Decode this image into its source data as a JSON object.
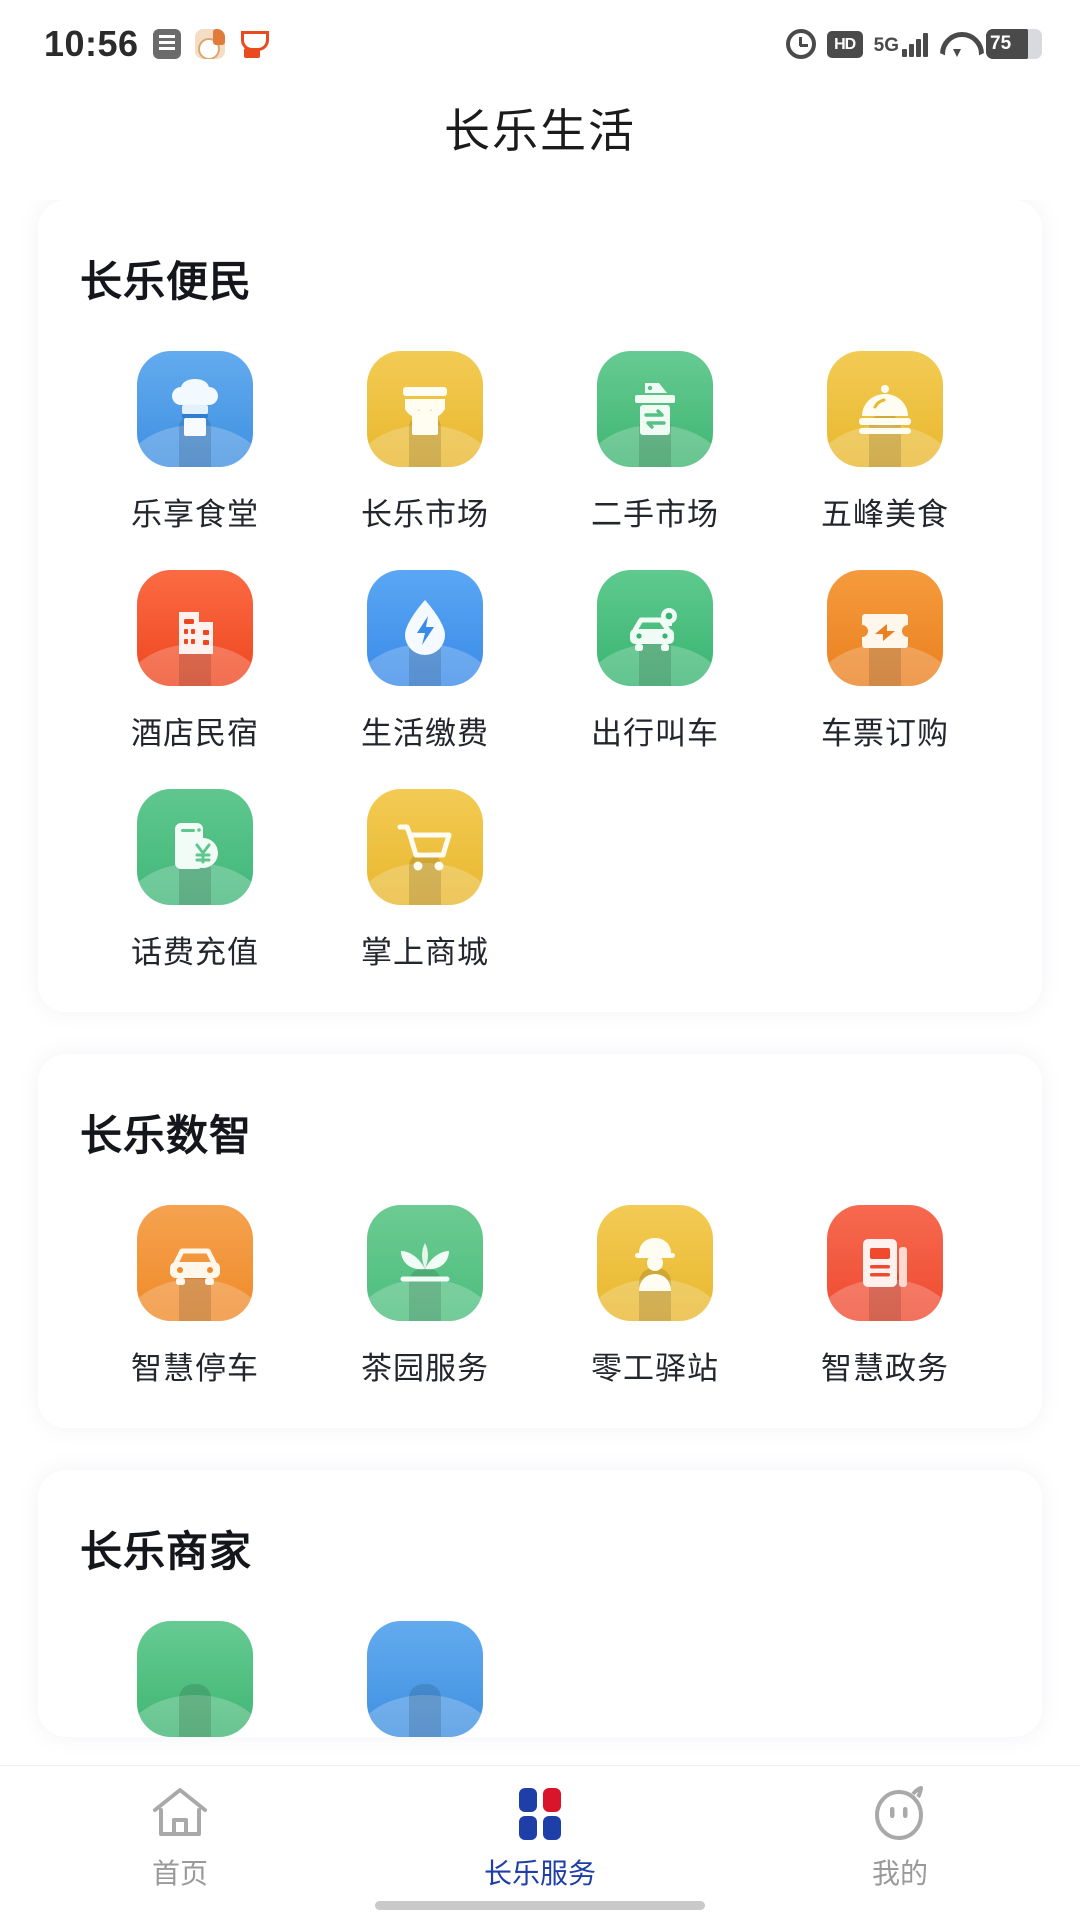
{
  "status_bar": {
    "time": "10:56",
    "left_icons": [
      "document-icon",
      "bear-app-icon",
      "cup-app-icon"
    ],
    "right_icons": [
      "alarm-icon",
      "hd-icon",
      "signal-5g-icon",
      "wifi-icon",
      "battery-icon"
    ],
    "hd_label": "HD",
    "network_label": "5G",
    "battery_level": "75"
  },
  "header": {
    "title": "长乐生活"
  },
  "sections": [
    {
      "title": "长乐便民",
      "items": [
        {
          "label": "乐享食堂",
          "icon": "chef-hat-icon",
          "color": "#4a9ce8",
          "color2": "#6fb6f2"
        },
        {
          "label": "长乐市场",
          "icon": "storefront-icon",
          "color": "#eec03c",
          "color2": "#f5d469"
        },
        {
          "label": "二手市场",
          "icon": "recycle-box-icon",
          "color": "#4fbf7e",
          "color2": "#74d49a"
        },
        {
          "label": "五峰美食",
          "icon": "food-cloche-icon",
          "color": "#eec03c",
          "color2": "#f5d469"
        },
        {
          "label": "酒店民宿",
          "icon": "hotel-building-icon",
          "color": "#f4502a",
          "color2": "#fa7350"
        },
        {
          "label": "生活缴费",
          "icon": "water-drop-bolt-icon",
          "color": "#3e92ef",
          "color2": "#68aef7"
        },
        {
          "label": "出行叫车",
          "icon": "taxi-car-icon",
          "color": "#46bd7b",
          "color2": "#6ed29b"
        },
        {
          "label": "车票订购",
          "icon": "ticket-icon",
          "color": "#ef8b2a",
          "color2": "#f7a busy"
        },
        {
          "label": "话费充值",
          "icon": "phone-recharge-icon",
          "color": "#54bd85",
          "color2": "#7ad2a3"
        },
        {
          "label": "掌上商城",
          "icon": "shopping-cart-icon",
          "color": "#eec03c",
          "color2": "#f5d469"
        }
      ]
    },
    {
      "title": "长乐数智",
      "items": [
        {
          "label": "智慧停车",
          "icon": "parking-car-icon",
          "color": "#f0902f",
          "color2": "#f7af5f"
        },
        {
          "label": "茶园服务",
          "icon": "tea-leaf-icon",
          "color": "#5cc080",
          "color2": "#80d4a0"
        },
        {
          "label": "零工驿站",
          "icon": "worker-icon",
          "color": "#eec03c",
          "color2": "#f5d469"
        },
        {
          "label": "智慧政务",
          "icon": "document-gov-icon",
          "color": "#f2523a",
          "color2": "#f87a65"
        }
      ]
    },
    {
      "title": "长乐商家",
      "items": [
        {
          "label": "",
          "icon": "merchant-green-icon",
          "color": "#4fbf7e",
          "color2": "#74d49a"
        },
        {
          "label": "",
          "icon": "merchant-blue-icon",
          "color": "#4a9ce8",
          "color2": "#6fb6f2"
        }
      ]
    }
  ],
  "bottom_nav": {
    "active_color": "#1f3fa8",
    "inactive_color": "#9a9a9a",
    "items": [
      {
        "label": "首页",
        "icon": "home-icon",
        "active": false
      },
      {
        "label": "长乐服务",
        "icon": "grid-squares-icon",
        "active": true
      },
      {
        "label": "我的",
        "icon": "profile-face-icon",
        "active": false
      }
    ]
  }
}
